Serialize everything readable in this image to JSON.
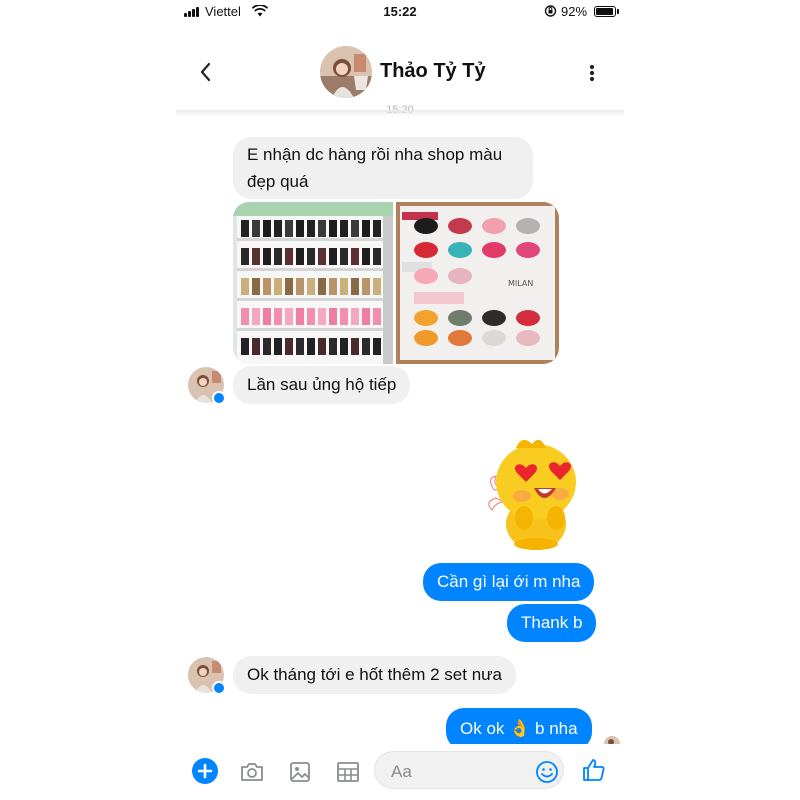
{
  "status_bar": {
    "carrier": "Viettel",
    "time": "15:22",
    "battery": "92%",
    "battery_level": 0.92
  },
  "header": {
    "contact_name": "Thảo Tỷ Tỷ",
    "back_icon": "chevron-left-icon",
    "more_icon": "vertical-dots-icon"
  },
  "timestamp": "15:20",
  "messages": [
    {
      "sender": "contact",
      "text": "E nhận dc hàng rồi nha shop màu\nđẹp quá"
    },
    {
      "sender": "contact",
      "type": "photos",
      "photos": [
        "nail-polish-shelf",
        "nail-color-chart"
      ]
    },
    {
      "sender": "contact",
      "text": "Lần sau ủng hộ tiếp"
    },
    {
      "sender": "me",
      "type": "sticker",
      "sticker": "heart-eyes-chick"
    },
    {
      "sender": "me",
      "text": "Cần gì lại ới m nha"
    },
    {
      "sender": "me",
      "text": "Thank b"
    },
    {
      "sender": "contact",
      "text": "Ok tháng tới e hốt thêm 2 set nưa"
    },
    {
      "sender": "me",
      "text": "Ok ok 👌 b nha"
    }
  ],
  "composer": {
    "placeholder": "Aa",
    "icons": [
      "plus-icon",
      "camera-icon",
      "photo-icon",
      "sticker-icon",
      "emoji-icon",
      "thumbs-up-icon"
    ]
  },
  "colors": {
    "accent": "#0084ff",
    "incoming_bubble": "#f0f0f0"
  }
}
